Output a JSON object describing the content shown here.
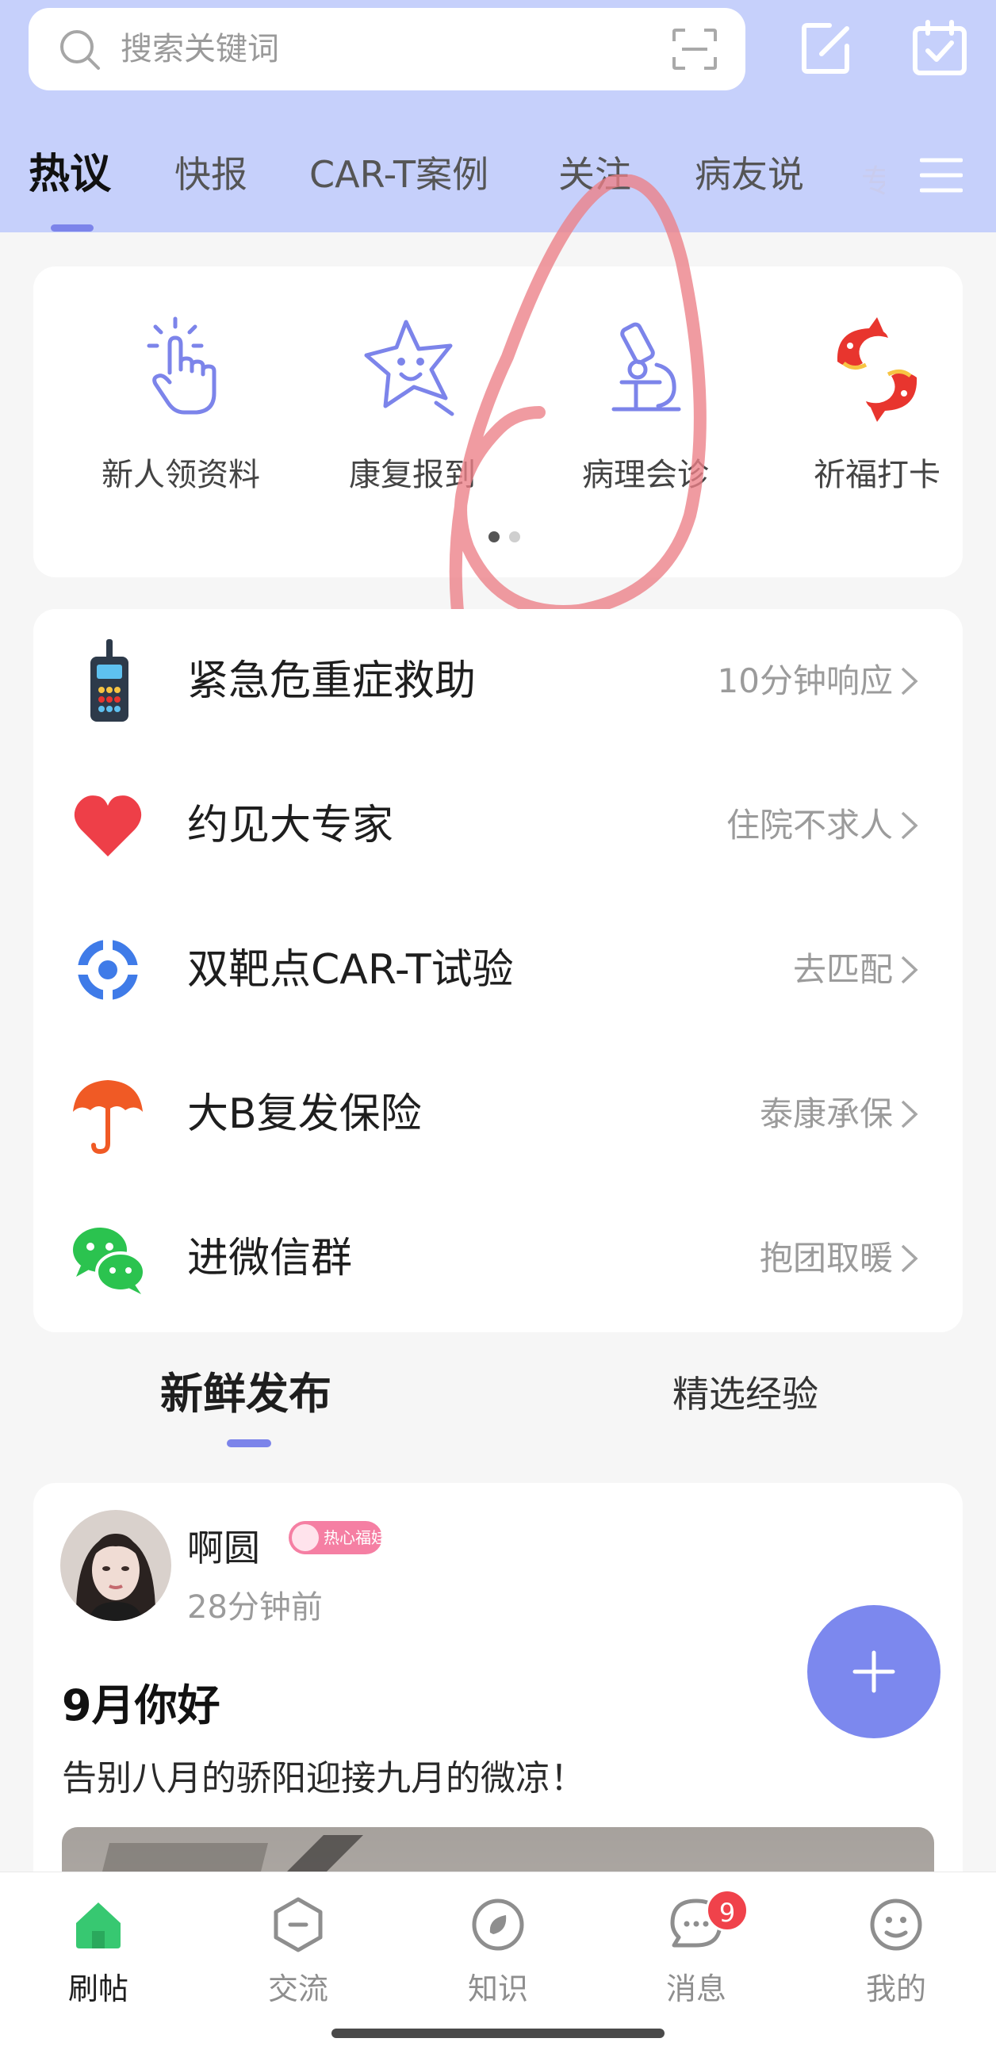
{
  "search": {
    "placeholder": "搜索关键词"
  },
  "header": {
    "tabs": [
      {
        "label": "热议",
        "active": true
      },
      {
        "label": "快报"
      },
      {
        "label": "CAR-T案例"
      },
      {
        "label": "关注"
      },
      {
        "label": "病友说"
      }
    ],
    "tab_fade_glyph": "专"
  },
  "quick_entries": [
    {
      "label": "新人领资料",
      "icon": "tap-hand-icon"
    },
    {
      "label": "康复报到",
      "icon": "star-face-icon"
    },
    {
      "label": "病理会诊",
      "icon": "microscope-icon"
    },
    {
      "label": "祈福打卡",
      "icon": "koi-fish-icon"
    }
  ],
  "quick_pager": {
    "pages": 2,
    "current": 1
  },
  "services": [
    {
      "title": "紧急危重症救助",
      "hint": "10分钟响应",
      "icon": "walkie-talkie-icon"
    },
    {
      "title": "约见大专家",
      "hint": "住院不求人",
      "icon": "heart-icon"
    },
    {
      "title": "双靶点CAR-T试验",
      "hint": "去匹配",
      "icon": "target-icon"
    },
    {
      "title": "大B复发保险",
      "hint": "泰康承保",
      "icon": "umbrella-icon"
    },
    {
      "title": "进微信群",
      "hint": "抱团取暖",
      "icon": "wechat-icon"
    }
  ],
  "feed_tabs": {
    "active": "新鲜发布",
    "other": "精选经验"
  },
  "post": {
    "username": "啊圆",
    "badge": "热心福娃",
    "time": "28分钟前",
    "title": "9月你好",
    "text": "告别八月的骄阳迎接九月的微凉！"
  },
  "bottom_nav": [
    {
      "label": "刷帖",
      "active": true,
      "icon": "home-icon"
    },
    {
      "label": "交流",
      "icon": "hexagon-minus-icon"
    },
    {
      "label": "知识",
      "icon": "knowledge-icon"
    },
    {
      "label": "消息",
      "icon": "chat-bubble-icon"
    },
    {
      "label": "我的",
      "icon": "face-icon"
    }
  ],
  "message_badge": "9",
  "colors": {
    "accent": "#7c84ea",
    "header_bg": "#c6d0fb",
    "badge_red": "#f0424b",
    "home_green": "#37c871"
  }
}
